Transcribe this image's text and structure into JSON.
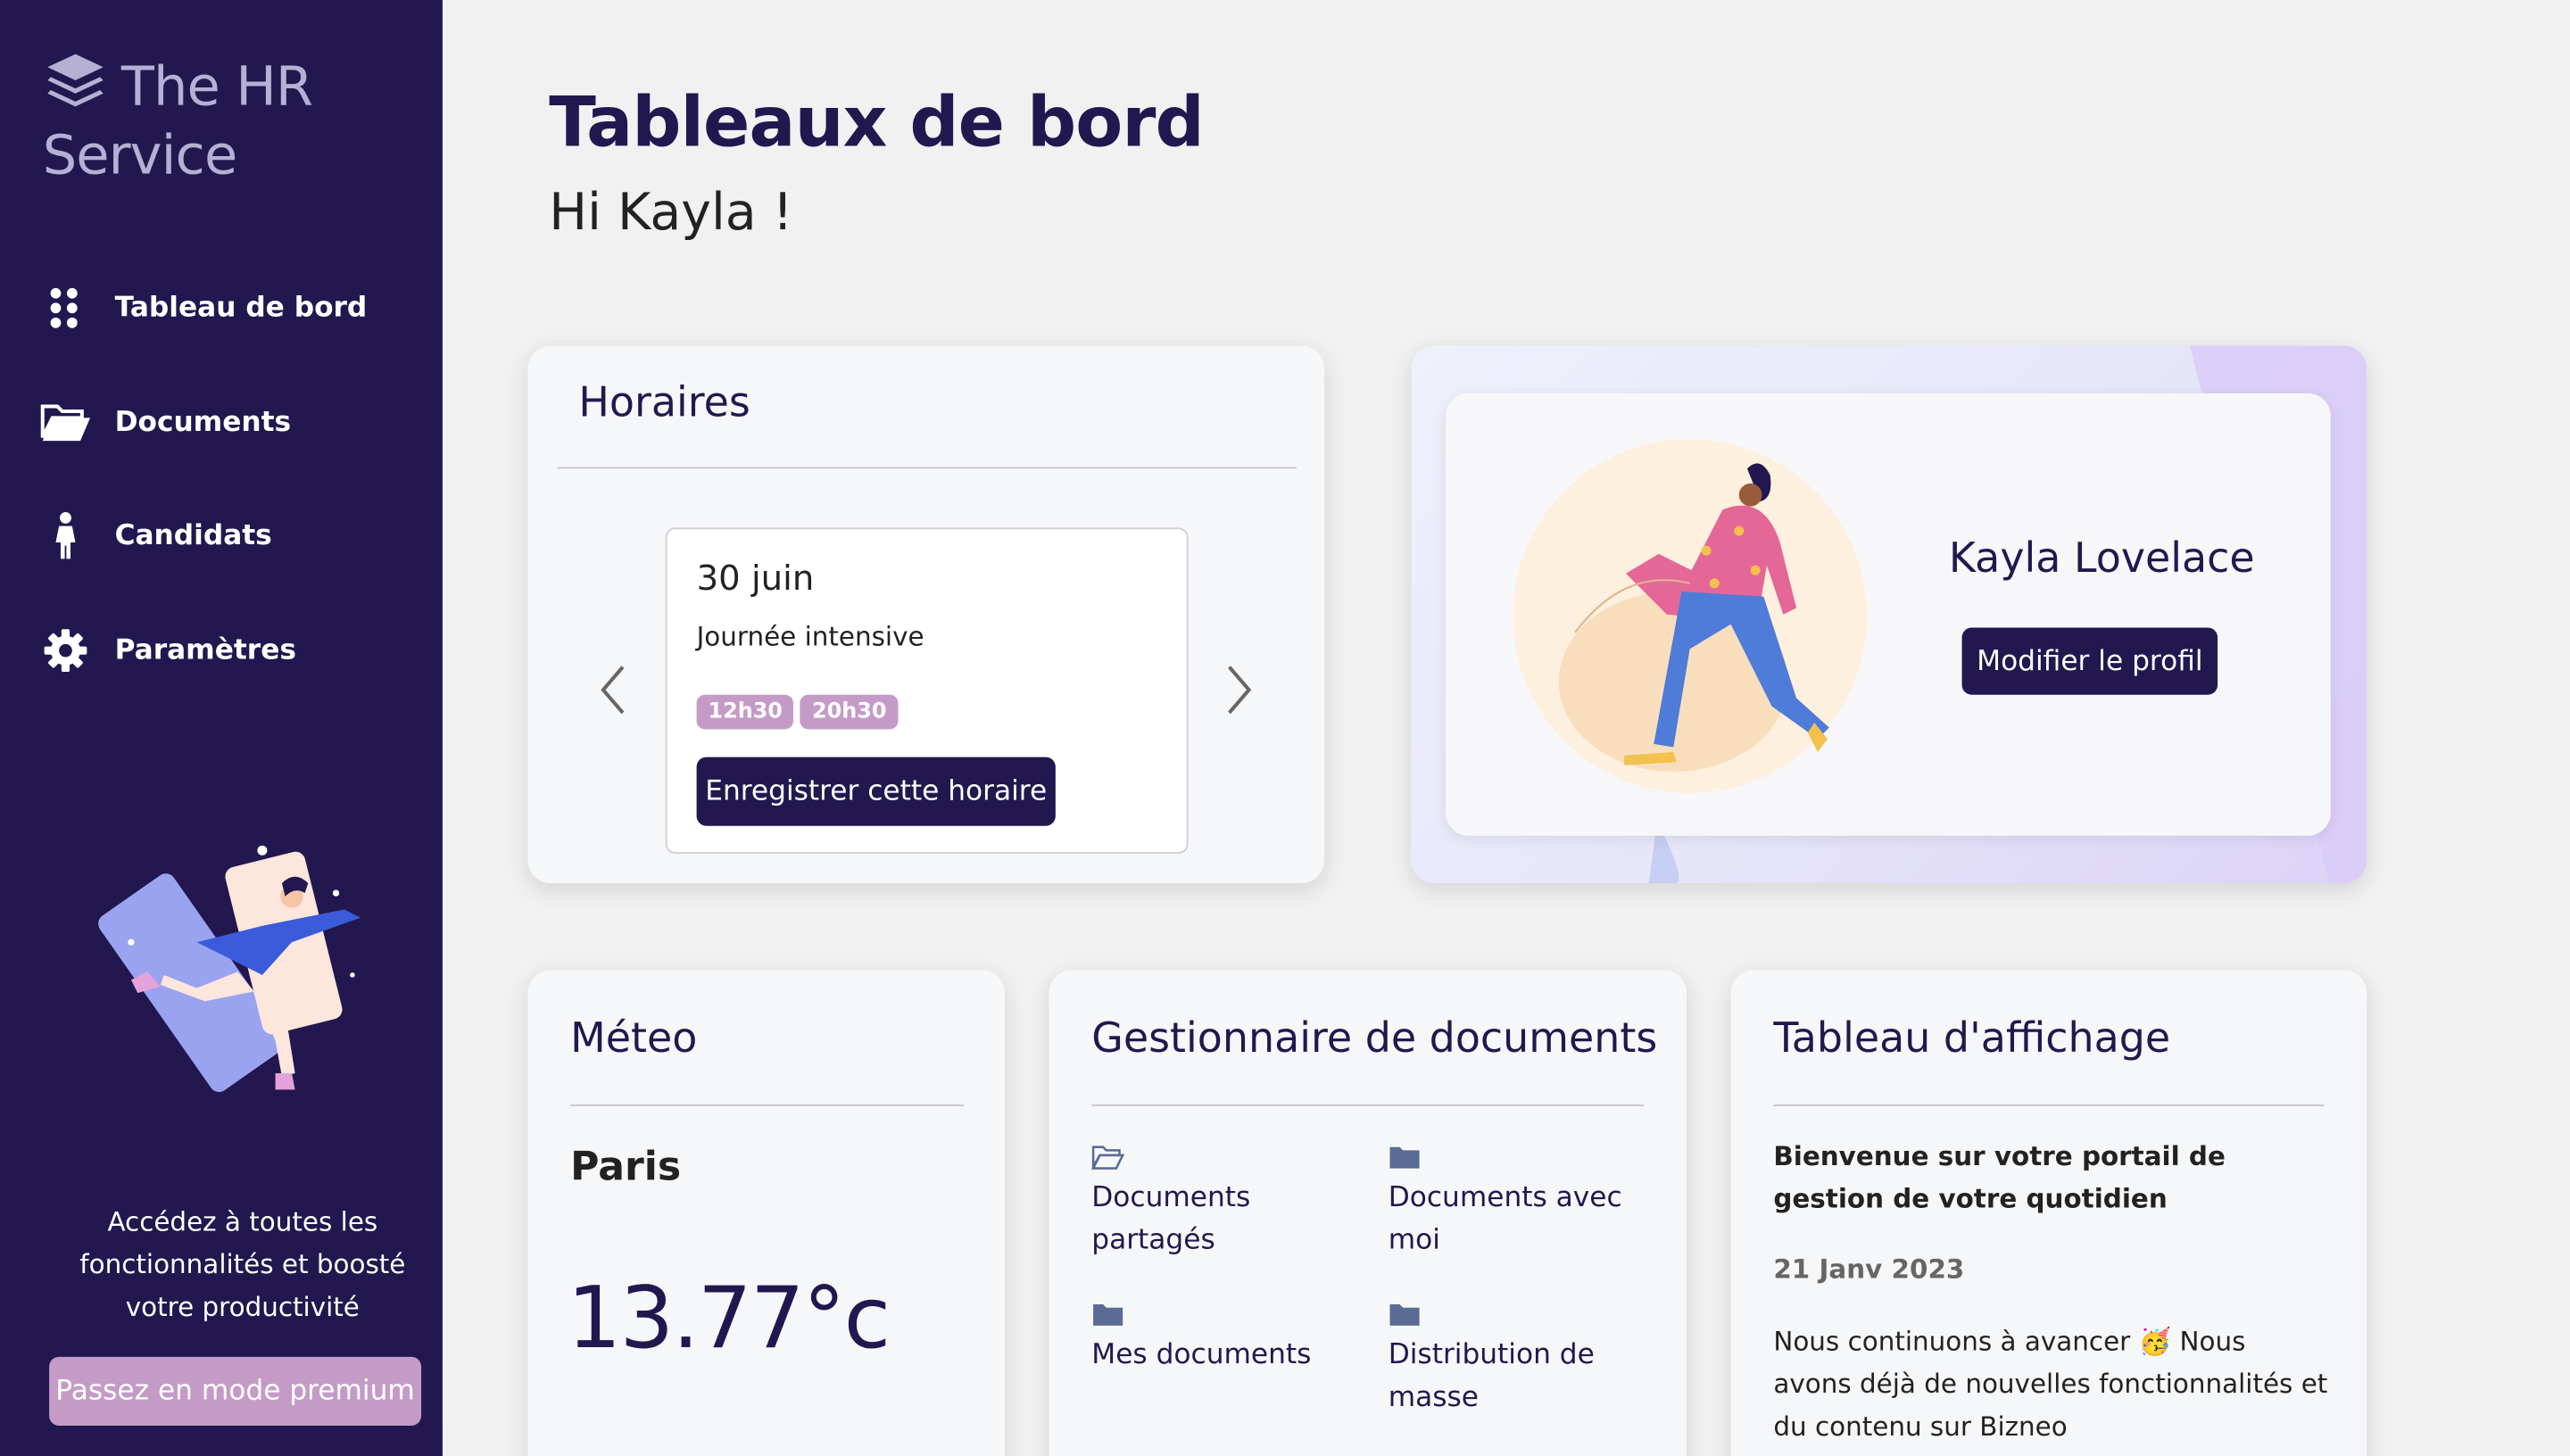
{
  "brand": {
    "name": "The HR Service",
    "icon": "layers-icon"
  },
  "sidebar": {
    "items": [
      {
        "label": "Tableau de bord",
        "icon": "grid-dots-icon"
      },
      {
        "label": "Documents",
        "icon": "folder-open-icon"
      },
      {
        "label": "Candidats",
        "icon": "person-icon"
      },
      {
        "label": "Paramètres",
        "icon": "gear-icon"
      }
    ],
    "promo_text": "Accédez à toutes les fonctionnalités et boosté votre productivité",
    "premium_button": "Passez en mode premium"
  },
  "header": {
    "title": "Tableaux de bord",
    "greeting": "Hi Kayla !"
  },
  "schedule": {
    "title": "Horaires",
    "date": "30 juin",
    "type": "Journée intensive",
    "times": [
      "12h30",
      "20h30"
    ],
    "save_button": "Enregistrer cette horaire"
  },
  "profile": {
    "name": "Kayla Lovelace",
    "edit_button": "Modifier le profil"
  },
  "weather": {
    "title": "Méteo",
    "city": "Paris",
    "temperature": "13.77°c"
  },
  "documents": {
    "title": "Gestionnaire de documents",
    "items": [
      {
        "label": "Documents partagés",
        "icon": "folder-open-icon"
      },
      {
        "label": "Documents avec moi",
        "icon": "folder-icon"
      },
      {
        "label": "Mes documents",
        "icon": "folder-icon"
      },
      {
        "label": "Distribution de masse",
        "icon": "folder-icon"
      }
    ]
  },
  "board": {
    "title": "Tableau d'affichage",
    "headline": "Bienvenue sur votre portail de gestion de votre quotidien",
    "date": "21 Janv 2023",
    "text": "Nous continuons à avancer 🥳 Nous avons déjà de nouvelles fonctionnalités et du contenu sur Bizneo"
  },
  "colors": {
    "sidebar": "#22184f",
    "accent": "#c49bc7",
    "primary_text": "#22184f",
    "background": "#f1f1f1"
  }
}
